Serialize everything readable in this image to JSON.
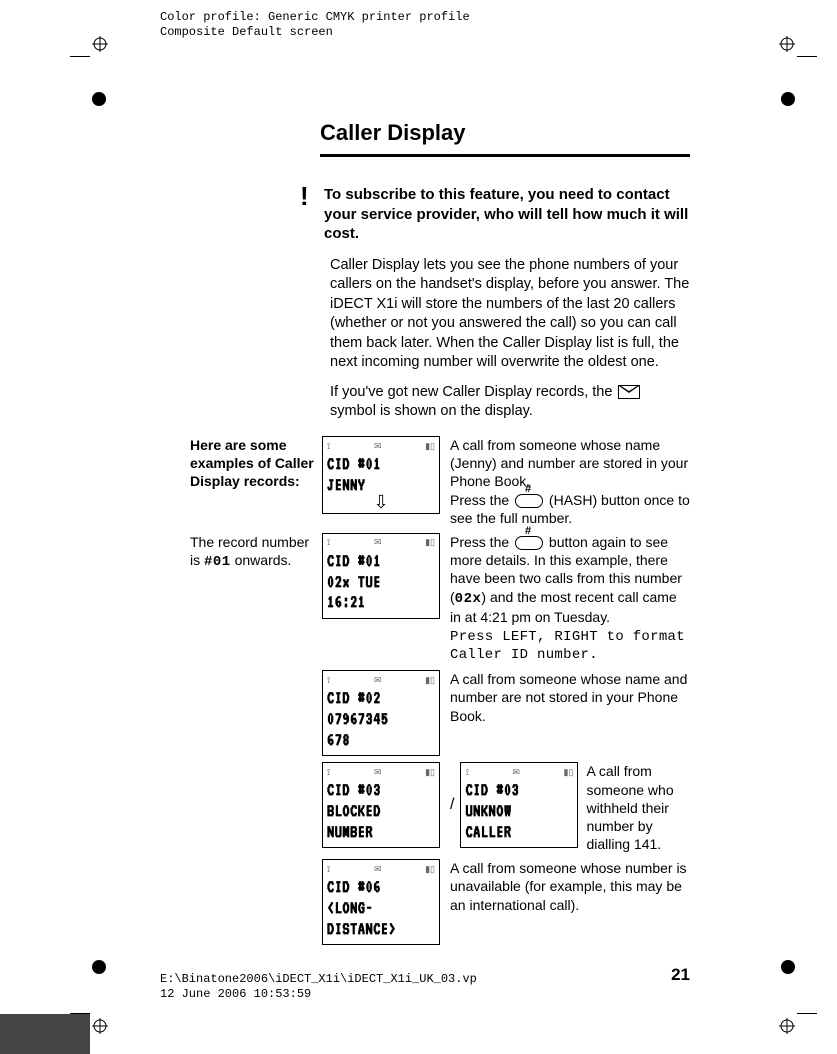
{
  "print_header": {
    "line1": "Color profile: Generic CMYK printer profile",
    "line2": "Composite  Default screen"
  },
  "print_footer": {
    "line1": "E:\\Binatone2006\\iDECT_X1i\\iDECT_X1i_UK_03.vp",
    "line2": "12 June 2006 10:53:59"
  },
  "title": "Caller Display",
  "alert": "To subscribe to this feature, you need to contact your service provider, who will tell how much it will cost.",
  "intro1": "Caller Display lets you see the phone numbers of your callers on the handset's display, before you answer. The iDECT X1i will store the numbers of the last 20 callers (whether or not you answered the call) so you can call them back later. When the Caller Display list is full, the next incoming number will overwrite the oldest one.",
  "intro2a": "If you've got new Caller Display records, the ",
  "intro2b": " symbol is shown on the display.",
  "left_intro": "Here are some examples of Caller Display records:",
  "left_note_a": "The record number is ",
  "left_note_num": "#01",
  "left_note_b": " onwards.",
  "lcd1": "CID #01\nJENNY",
  "desc1a": "A call from someone whose name (Jenny) and number are stored in your Phone Book.",
  "desc1b_a": "Press the ",
  "desc1b_b": " (HASH) button once to see the full number.",
  "lcd2": "CID #01\n02x TUE\n16:21",
  "desc2_a": "Press the ",
  "desc2_b": " button again to see more details. In this example, there have been two calls from this number (",
  "desc2_code": "02x",
  "desc2_c": ") and the most recent call came in at 4:21 pm on Tuesday.",
  "desc2_d": "Press LEFT, RIGHT to format Caller ID number.",
  "lcd3": "CID #02\n07967345\n678",
  "desc3": "A call from someone whose name and number are not stored in your Phone Book.",
  "lcd4a": "CID #03\nBLOCKED\nNUMBER",
  "lcd4b": "CID #03\nUNKNOW\nCALLER",
  "desc4": "A call from someone who withheld their number by dialling 141.",
  "lcd5": "CID #06\n<LONG-\nDISTANCE>",
  "desc5": "A call from someone whose number is unavailable (for example, this may be an international call).",
  "page_number": "21"
}
